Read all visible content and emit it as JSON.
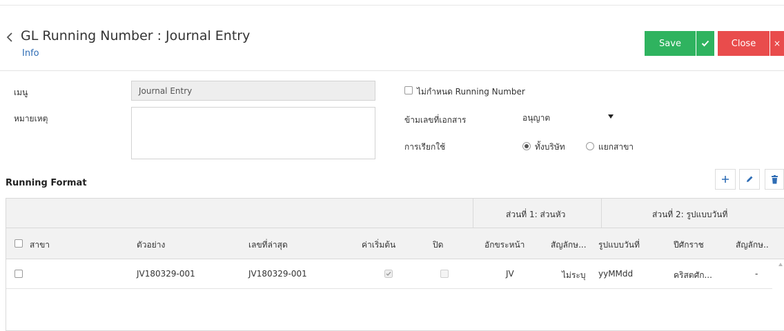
{
  "header": {
    "title": "GL Running Number : Journal Entry",
    "subtitle": "Info",
    "save_label": "Save",
    "close_label": "Close",
    "close_x": "×"
  },
  "form": {
    "menu_label": "เมนู",
    "menu_value": "Journal Entry",
    "remark_label": "หมายเหตุ",
    "no_running_label": "ไม่กำหนด Running Number",
    "skip_doc_label": "ข้ามเลขที่เอกสาร",
    "skip_doc_value": "อนุญาต",
    "usage_label": "การเรียกใช้",
    "usage_options": [
      "ทั้งบริษัท",
      "แยกสาขา"
    ]
  },
  "running_format": {
    "title": "Running Format",
    "group_headers": [
      "ส่วนที่ 1: ส่วนหัว",
      "ส่วนที่ 2: รูปแบบวันที่"
    ],
    "columns": [
      "สาขา",
      "ตัวอย่าง",
      "เลขที่ล่าสุด",
      "ค่าเริ่มต้น",
      "ปิด",
      "อักขระหน้า",
      "สัญลักษ...",
      "รูปแบบวันที่",
      "ปีศักราช",
      "สัญลักษ.."
    ],
    "rows": [
      {
        "branch": "",
        "example": "JV180329-001",
        "last_number": "JV180329-001",
        "default": true,
        "closed": false,
        "prefix": "JV",
        "symbol": "ไม่ระบุ",
        "date_format": "yyMMdd",
        "era": "คริสตศัก...",
        "symbol2": "-"
      }
    ]
  },
  "colors": {
    "save": "#2fb35f",
    "close": "#e94c4c",
    "link": "#2f6db5",
    "toolbar_icon": "#2f6db5"
  },
  "icons": [
    "chevron-left-icon",
    "check-icon",
    "close-icon",
    "plus-icon",
    "pencil-icon",
    "trash-icon"
  ]
}
